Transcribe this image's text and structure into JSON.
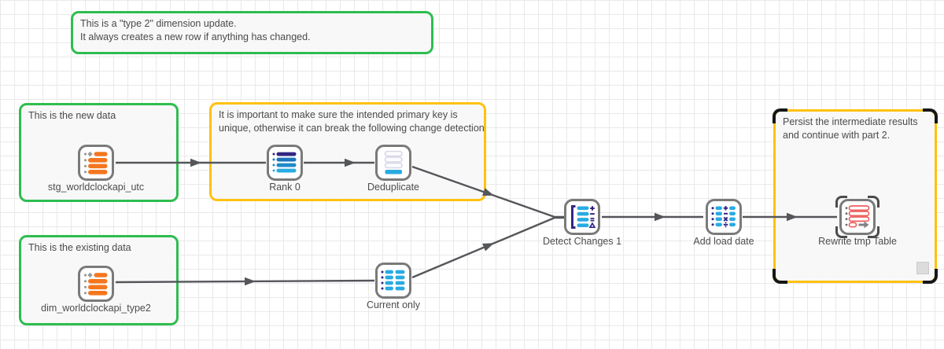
{
  "app": {
    "view": "transformation-workflow-canvas"
  },
  "colors": {
    "note_green": "#2ebd4f",
    "note_yellow": "#ffc20e",
    "edge_gray": "#54565a",
    "node_border_gray": "#7a7a7a",
    "table_orange": "#f4771f",
    "action_blue": "#29abe2",
    "action_navy": "#312783",
    "rewrite_red": "#ee5f5f"
  },
  "notes": {
    "type2": {
      "lines": [
        "This is a \"type 2\" dimension update.",
        "It always creates a new row if anything has changed."
      ]
    },
    "new_data": {
      "lines": [
        "This is the new data"
      ]
    },
    "primary_key": {
      "lines": [
        "It is important to make sure the intended primary key is",
        "unique, otherwise it can break the following change detection"
      ]
    },
    "existing_data": {
      "lines": [
        "This is the existing data"
      ]
    },
    "persist": {
      "lines": [
        "Persist the intermediate results",
        "and continue with part 2."
      ],
      "selected": true
    }
  },
  "nodes": {
    "stg": {
      "label": "stg_worldclockapi_utc",
      "icon": "table-orange-icon"
    },
    "rank": {
      "label": "Rank 0",
      "icon": "rank-icon"
    },
    "dedup": {
      "label": "Deduplicate",
      "icon": "deduplicate-icon"
    },
    "dim": {
      "label": "dim_worldclockapi_type2",
      "icon": "table-orange-icon"
    },
    "current": {
      "label": "Current only",
      "icon": "current-only-icon"
    },
    "detect": {
      "label": "Detect Changes 1",
      "icon": "detect-changes-icon"
    },
    "addload": {
      "label": "Add load date",
      "icon": "add-calculated-column-icon"
    },
    "rewrite": {
      "label": "Rewrite tmp Table",
      "icon": "rewrite-table-icon"
    }
  }
}
